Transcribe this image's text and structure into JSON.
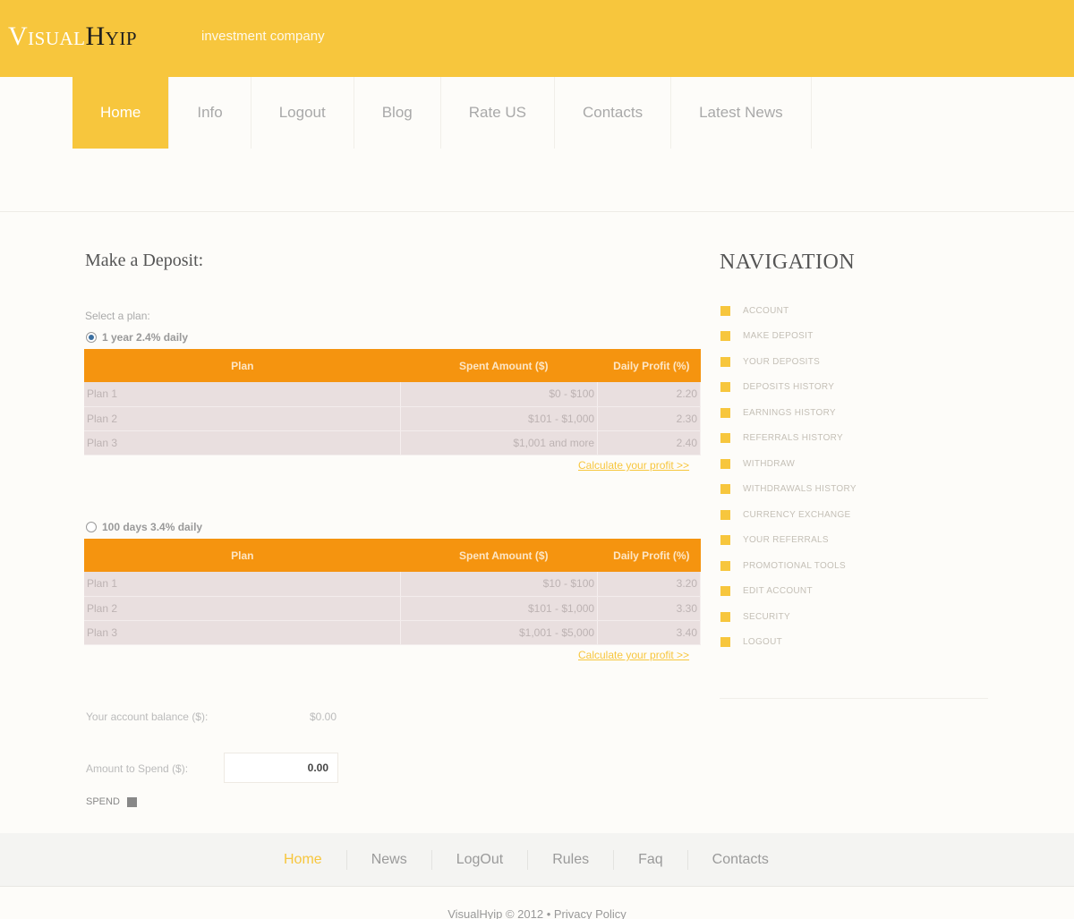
{
  "brand": {
    "logo_part1": "Visual",
    "logo_part2": "Hyip",
    "tagline": "investment company",
    "accent_color": "#f7c63d",
    "table_header_color": "#f5940f"
  },
  "topnav": [
    {
      "label": "Home",
      "active": true
    },
    {
      "label": "Info"
    },
    {
      "label": "Logout"
    },
    {
      "label": "Blog"
    },
    {
      "label": "Rate US"
    },
    {
      "label": "Contacts"
    },
    {
      "label": "Latest News"
    }
  ],
  "deposit": {
    "title": "Make a Deposit:",
    "select_label": "Select a plan:",
    "plans": [
      {
        "name": "1 year 2.4% daily",
        "selected": true,
        "headers": [
          "Plan",
          "Spent Amount ($)",
          "Daily Profit (%)"
        ],
        "rows": [
          [
            "Plan 1",
            "$0 - $100",
            "2.20"
          ],
          [
            "Plan 2",
            "$101 - $1,000",
            "2.30"
          ],
          [
            "Plan 3",
            "$1,001 and more",
            "2.40"
          ]
        ],
        "calc_link": "Calculate your profit >>"
      },
      {
        "name": "100 days 3.4% daily",
        "selected": false,
        "headers": [
          "Plan",
          "Spent Amount ($)",
          "Daily Profit (%)"
        ],
        "rows": [
          [
            "Plan 1",
            "$10 - $100",
            "3.20"
          ],
          [
            "Plan 2",
            "$101 - $1,000",
            "3.30"
          ],
          [
            "Plan 3",
            "$1,001 - $5,000",
            "3.40"
          ]
        ],
        "calc_link": "Calculate your profit >>"
      }
    ],
    "balance_label": "Your account balance ($):",
    "balance_value": "$0.00",
    "amount_label": "Amount to Spend ($):",
    "amount_value": "0.00",
    "spend_label": "SPEND"
  },
  "sidebar": {
    "title": "NAVIGATION",
    "items": [
      "ACCOUNT",
      "MAKE DEPOSIT",
      "YOUR DEPOSITS",
      "DEPOSITS HISTORY",
      "EARNINGS HISTORY",
      "REFERRALS HISTORY",
      "WITHDRAW",
      "WITHDRAWALS HISTORY",
      "CURRENCY EXCHANGE",
      "YOUR REFERRALS",
      "PROMOTIONAL TOOLS",
      "EDIT ACCOUNT",
      "SECURITY",
      "LOGOUT"
    ]
  },
  "footer": {
    "nav": [
      {
        "label": "Home",
        "active": true
      },
      {
        "label": "News"
      },
      {
        "label": "LogOut"
      },
      {
        "label": "Rules"
      },
      {
        "label": "Faq"
      },
      {
        "label": "Contacts"
      }
    ],
    "copyright": "VisualHyip © 2012 •",
    "privacy": "Privacy Policy"
  }
}
